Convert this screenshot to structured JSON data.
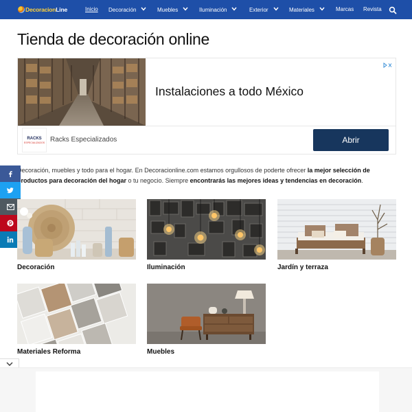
{
  "nav": {
    "logo_prefix": "Decoracion",
    "logo_suffix": "Line",
    "items": [
      {
        "label": "Inicio",
        "active": true,
        "dropdown": false
      },
      {
        "label": "Decoración",
        "active": false,
        "dropdown": true
      },
      {
        "label": "Muebles",
        "active": false,
        "dropdown": true
      },
      {
        "label": "Iluminación",
        "active": false,
        "dropdown": true
      },
      {
        "label": "Exterior",
        "active": false,
        "dropdown": true
      },
      {
        "label": "Materiales",
        "active": false,
        "dropdown": true
      },
      {
        "label": "Marcas",
        "active": false,
        "dropdown": false
      },
      {
        "label": "Revista",
        "active": false,
        "dropdown": false
      }
    ],
    "search_icon": "search-icon",
    "bg_color": "#1e4fa8"
  },
  "page": {
    "title": "Tienda de decoración online"
  },
  "ad": {
    "headline": "Instalaciones a todo México",
    "advertiser": "Racks Especializados",
    "logo_text": "RACKS",
    "logo_sub": "ESPECIALIZADOS",
    "cta": "Abrir",
    "cta_color": "#17365d"
  },
  "intro": {
    "t1": "Decoración, muebles y todo para el hogar. En Decoracionline.com estamos orgullosos de poderte ofrecer ",
    "b1": "la mejor selección de productos para decoración del hogar",
    "t2": " o tu negocio. Siempre ",
    "b2": "encontrarás las mejores ideas y tendencias en decoración",
    "t3": "."
  },
  "social": [
    "facebook-icon",
    "twitter-icon",
    "email-icon",
    "pinterest-icon",
    "linkedin-icon"
  ],
  "categories": [
    {
      "label": "Decoración"
    },
    {
      "label": "Iluminación"
    },
    {
      "label": "Jardín y terraza"
    },
    {
      "label": "Materiales Reforma"
    },
    {
      "label": "Muebles"
    }
  ]
}
